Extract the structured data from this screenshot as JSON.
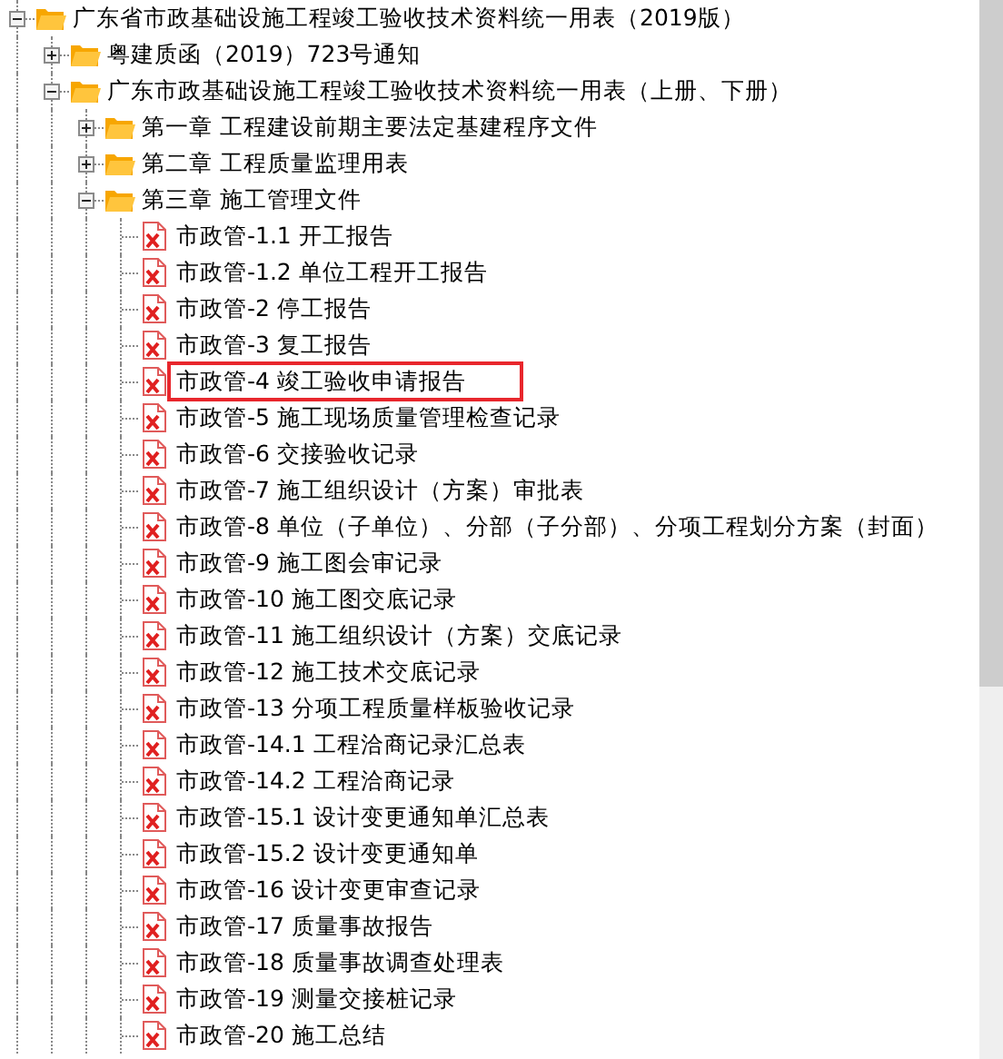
{
  "tree": [
    {
      "label": "广东省市政基础设施工程竣工验收技术资料统一用表（2019版）",
      "kind": "folder",
      "expanded": true,
      "children": [
        {
          "label": "粤建质函（2019）723号通知",
          "kind": "folder",
          "expanded": false
        },
        {
          "label": "广东市政基础设施工程竣工验收技术资料统一用表（上册、下册）",
          "kind": "folder",
          "expanded": true,
          "children": [
            {
              "label": "第一章  工程建设前期主要法定基建程序文件",
              "kind": "folder",
              "expanded": false
            },
            {
              "label": "第二章  工程质量监理用表",
              "kind": "folder",
              "expanded": false
            },
            {
              "label": "第三章  施工管理文件",
              "kind": "folder",
              "expanded": true,
              "children": [
                {
                  "label": "市政管-1.1 开工报告",
                  "kind": "file",
                  "highlighted": false
                },
                {
                  "label": "市政管-1.2 单位工程开工报告",
                  "kind": "file",
                  "highlighted": false
                },
                {
                  "label": "市政管-2 停工报告",
                  "kind": "file",
                  "highlighted": false
                },
                {
                  "label": "市政管-3 复工报告",
                  "kind": "file",
                  "highlighted": false
                },
                {
                  "label": "市政管-4 竣工验收申请报告",
                  "kind": "file",
                  "highlighted": true
                },
                {
                  "label": "市政管-5 施工现场质量管理检查记录",
                  "kind": "file",
                  "highlighted": false
                },
                {
                  "label": "市政管-6 交接验收记录",
                  "kind": "file",
                  "highlighted": false
                },
                {
                  "label": "市政管-7 施工组织设计（方案）审批表",
                  "kind": "file",
                  "highlighted": false
                },
                {
                  "label": "市政管-8 单位（子单位）、分部（子分部）、分项工程划分方案（封面）",
                  "kind": "file",
                  "highlighted": false
                },
                {
                  "label": "市政管-9 施工图会审记录",
                  "kind": "file",
                  "highlighted": false
                },
                {
                  "label": "市政管-10 施工图交底记录",
                  "kind": "file",
                  "highlighted": false
                },
                {
                  "label": "市政管-11 施工组织设计（方案）交底记录",
                  "kind": "file",
                  "highlighted": false
                },
                {
                  "label": "市政管-12 施工技术交底记录",
                  "kind": "file",
                  "highlighted": false
                },
                {
                  "label": "市政管-13 分项工程质量样板验收记录",
                  "kind": "file",
                  "highlighted": false
                },
                {
                  "label": "市政管-14.1 工程洽商记录汇总表",
                  "kind": "file",
                  "highlighted": false
                },
                {
                  "label": "市政管-14.2 工程洽商记录",
                  "kind": "file",
                  "highlighted": false
                },
                {
                  "label": "市政管-15.1 设计变更通知单汇总表",
                  "kind": "file",
                  "highlighted": false
                },
                {
                  "label": "市政管-15.2 设计变更通知单",
                  "kind": "file",
                  "highlighted": false
                },
                {
                  "label": "市政管-16 设计变更审查记录",
                  "kind": "file",
                  "highlighted": false
                },
                {
                  "label": "市政管-17 质量事故报告",
                  "kind": "file",
                  "highlighted": false
                },
                {
                  "label": "市政管-18 质量事故调查处理表",
                  "kind": "file",
                  "highlighted": false
                },
                {
                  "label": "市政管-19 测量交接桩记录",
                  "kind": "file",
                  "highlighted": false
                },
                {
                  "label": "市政管-20 施工总结",
                  "kind": "file",
                  "highlighted": false
                }
              ]
            }
          ]
        }
      ]
    }
  ]
}
